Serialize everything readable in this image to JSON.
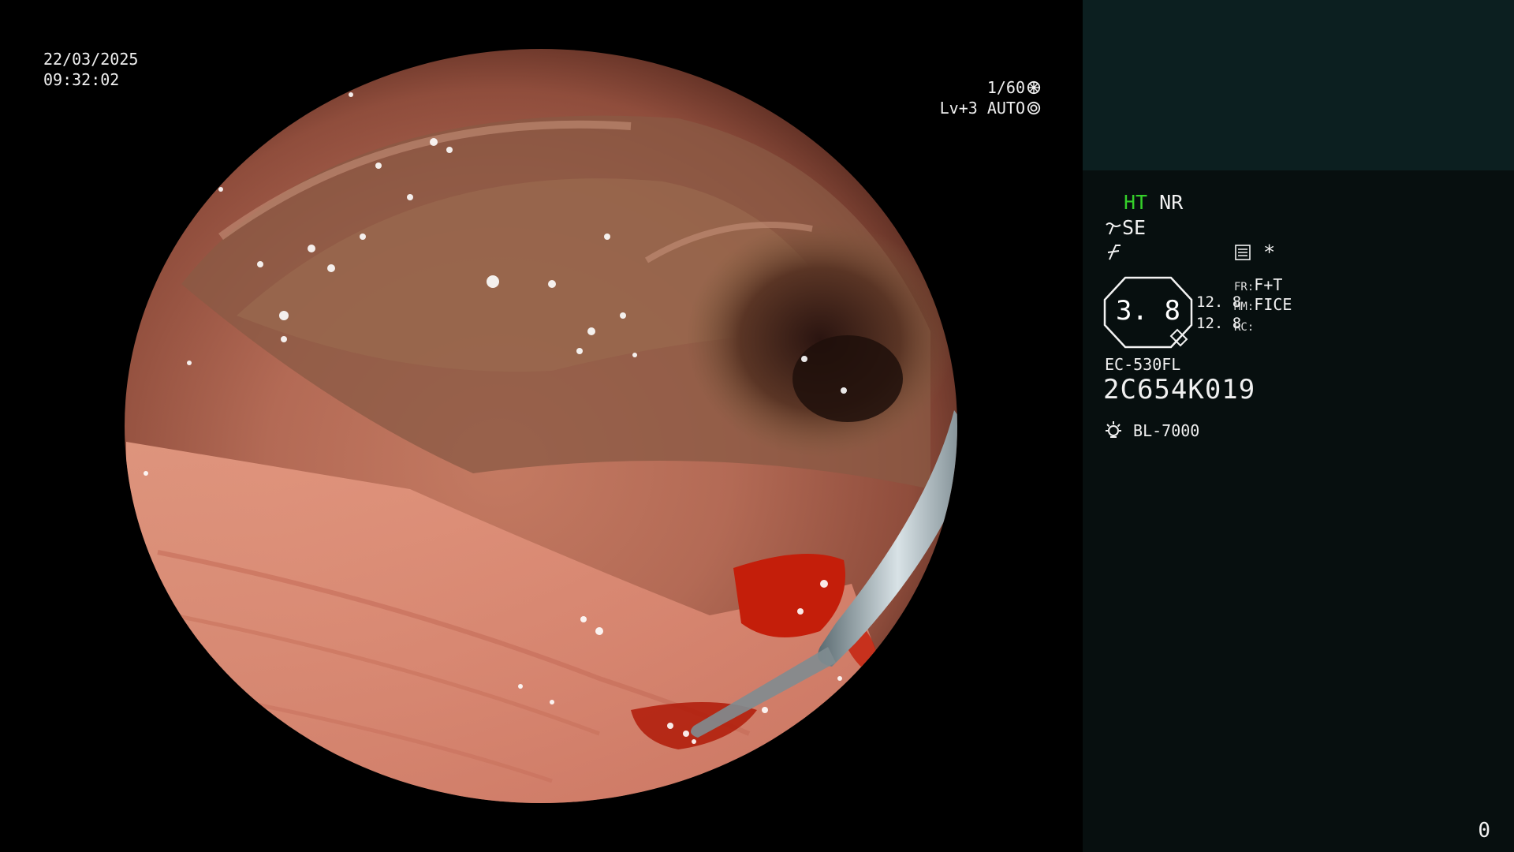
{
  "overlay": {
    "date": "22/03/2025",
    "time": "09:32:02",
    "shutter": "1/60",
    "level": "Lv+3 AUTO",
    "shutter_icon": "aperture-icon",
    "auto_icon": "iris-icon"
  },
  "panel": {
    "mode_ht": "HT",
    "mode_nr": "NR",
    "se_label": "SE",
    "se_icon": "tilde-arrow-icon",
    "f_icon": "f-slash-icon",
    "menu_icon": "list-panel-icon",
    "star": "*",
    "gauge_value": "3. 8",
    "val_1": "12. 8",
    "val_2": "12. 8",
    "fr_tag": "FR:",
    "fr_value": "F+T",
    "mm_tag": "MM:",
    "mm_value": "FICE",
    "rc_tag": "RC:",
    "rc_value": "",
    "scope_model": "EC-530FL",
    "scope_serial": "2C654K019",
    "light_icon": "lamp-icon",
    "light_source": "BL-7000",
    "counter": "0"
  },
  "colors": {
    "panel_bg": "#070f0f",
    "panel_top_bg": "#0c1f20",
    "ht_green": "#35d02a"
  }
}
